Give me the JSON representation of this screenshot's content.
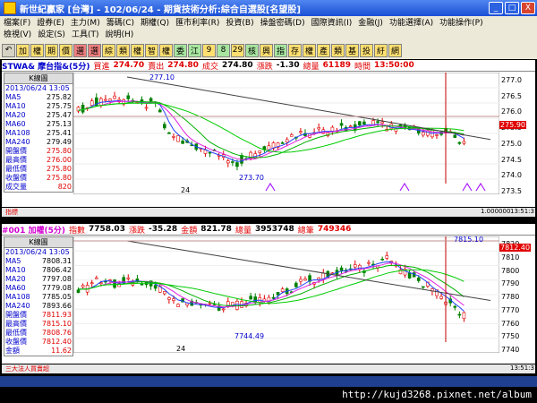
{
  "window": {
    "title": "新世紀贏家 [台灣] - 102/06/24 - 期貨技術分析:綜合自選股[名望股]",
    "btns": [
      "_",
      "□",
      "X"
    ]
  },
  "menu": {
    "row1": [
      "檔案(F)",
      "證券(E)",
      "主力(M)",
      "籌碼(C)",
      "期權(Q)",
      "匯市利率(R)",
      "投資(B)",
      "操盤密碼(D)",
      "國際資訊(I)",
      "金融(J)",
      "功能選擇(A)",
      "功能操作(P)"
    ],
    "row2": [
      "檢視(V)",
      "設定(S)",
      "工具(T)",
      "說明(H)"
    ]
  },
  "toolbar": [
    "↶",
    "加",
    "權",
    "期",
    "價",
    "選",
    "選",
    "綜",
    "類",
    "權",
    "智",
    "權",
    "委",
    "江",
    "9",
    "8",
    "29",
    "核",
    "興",
    "指",
    "存",
    "權",
    "產",
    "類",
    "基",
    "投",
    "紆",
    "網"
  ],
  "top": {
    "info": {
      "sym": "STWA& 摩台指&(5分)",
      "buy_l": "買進",
      "buy": "274.70",
      "sell_l": "賣出",
      "sell": "274.80",
      "deal_l": "成交",
      "deal": "274.80",
      "chg_l": "漲跌",
      "chg": "-1.30",
      "vol_l": "總量",
      "vol": "61189",
      "time_l": "時間",
      "time": "13:50:00"
    },
    "kbox": {
      "head": "K線圖",
      "date": "2013/06/24 13:05",
      "rows": [
        [
          "MA5",
          "275.82"
        ],
        [
          "MA10",
          "275.75"
        ],
        [
          "MA20",
          "275.47"
        ],
        [
          "MA60",
          "275.13"
        ],
        [
          "MA108",
          "275.41"
        ],
        [
          "MA240",
          "279.49"
        ],
        [
          "開盤價",
          "275.80"
        ],
        [
          "最高價",
          "276.00"
        ],
        [
          "最低價",
          "275.80"
        ],
        [
          "收盤價",
          "275.80"
        ],
        [
          "成交量",
          "820"
        ]
      ]
    },
    "yticks": [
      "277.0",
      "276.5",
      "276.0",
      "275.5",
      "275.0",
      "274.5",
      "274.0",
      "273.5"
    ],
    "marker": "275.90",
    "hi_label": "277.10",
    "lo_label": "273.70",
    "x_label": "24",
    "sub": "指標",
    "sub2": "1.000000",
    "sub3": "13:51:31"
  },
  "bottom": {
    "info": {
      "sym": "#001 加權(5分)",
      "idx_l": "指數",
      "idx": "7758.03",
      "chg_l": "漲跌",
      "chg": "-35.28",
      "amt_l": "金額",
      "amt": "821.78",
      "vol_l": "總量",
      "vol": "3953748",
      "cnt_l": "總筆",
      "cnt": "749346"
    },
    "kbox": {
      "head": "K線圖",
      "date": "2013/06/24 13:05",
      "rows": [
        [
          "MA5",
          "7808.31"
        ],
        [
          "MA10",
          "7806.42"
        ],
        [
          "MA20",
          "7797.08"
        ],
        [
          "MA60",
          "7779.08"
        ],
        [
          "MA108",
          "7785.05"
        ],
        [
          "MA240",
          "7893.66"
        ],
        [
          "開盤價",
          "7811.93"
        ],
        [
          "最高價",
          "7815.10"
        ],
        [
          "最低價",
          "7808.76"
        ],
        [
          "收盤價",
          "7812.40"
        ],
        [
          "金額",
          "11.62"
        ]
      ]
    },
    "yticks": [
      "7820",
      "7810",
      "7800",
      "7790",
      "7780",
      "7770",
      "7760",
      "7750",
      "7740"
    ],
    "marker": "7812.40",
    "hi_label": "7815.10",
    "lo_label": "7744.49",
    "x_label": "24",
    "sub": "三大法人買賣超",
    "sub2": "13:51:31"
  },
  "status": {
    "url": "http://kujd3268.pixnet.net/album"
  },
  "colors": {
    "ma5": "#2040ff",
    "ma10": "#e020e0",
    "ma20": "#00b000",
    "ma60": "#00cc00",
    "ma108": "#404040",
    "ma240": "#c06000",
    "up": "#e00000",
    "down": "#008000"
  }
}
